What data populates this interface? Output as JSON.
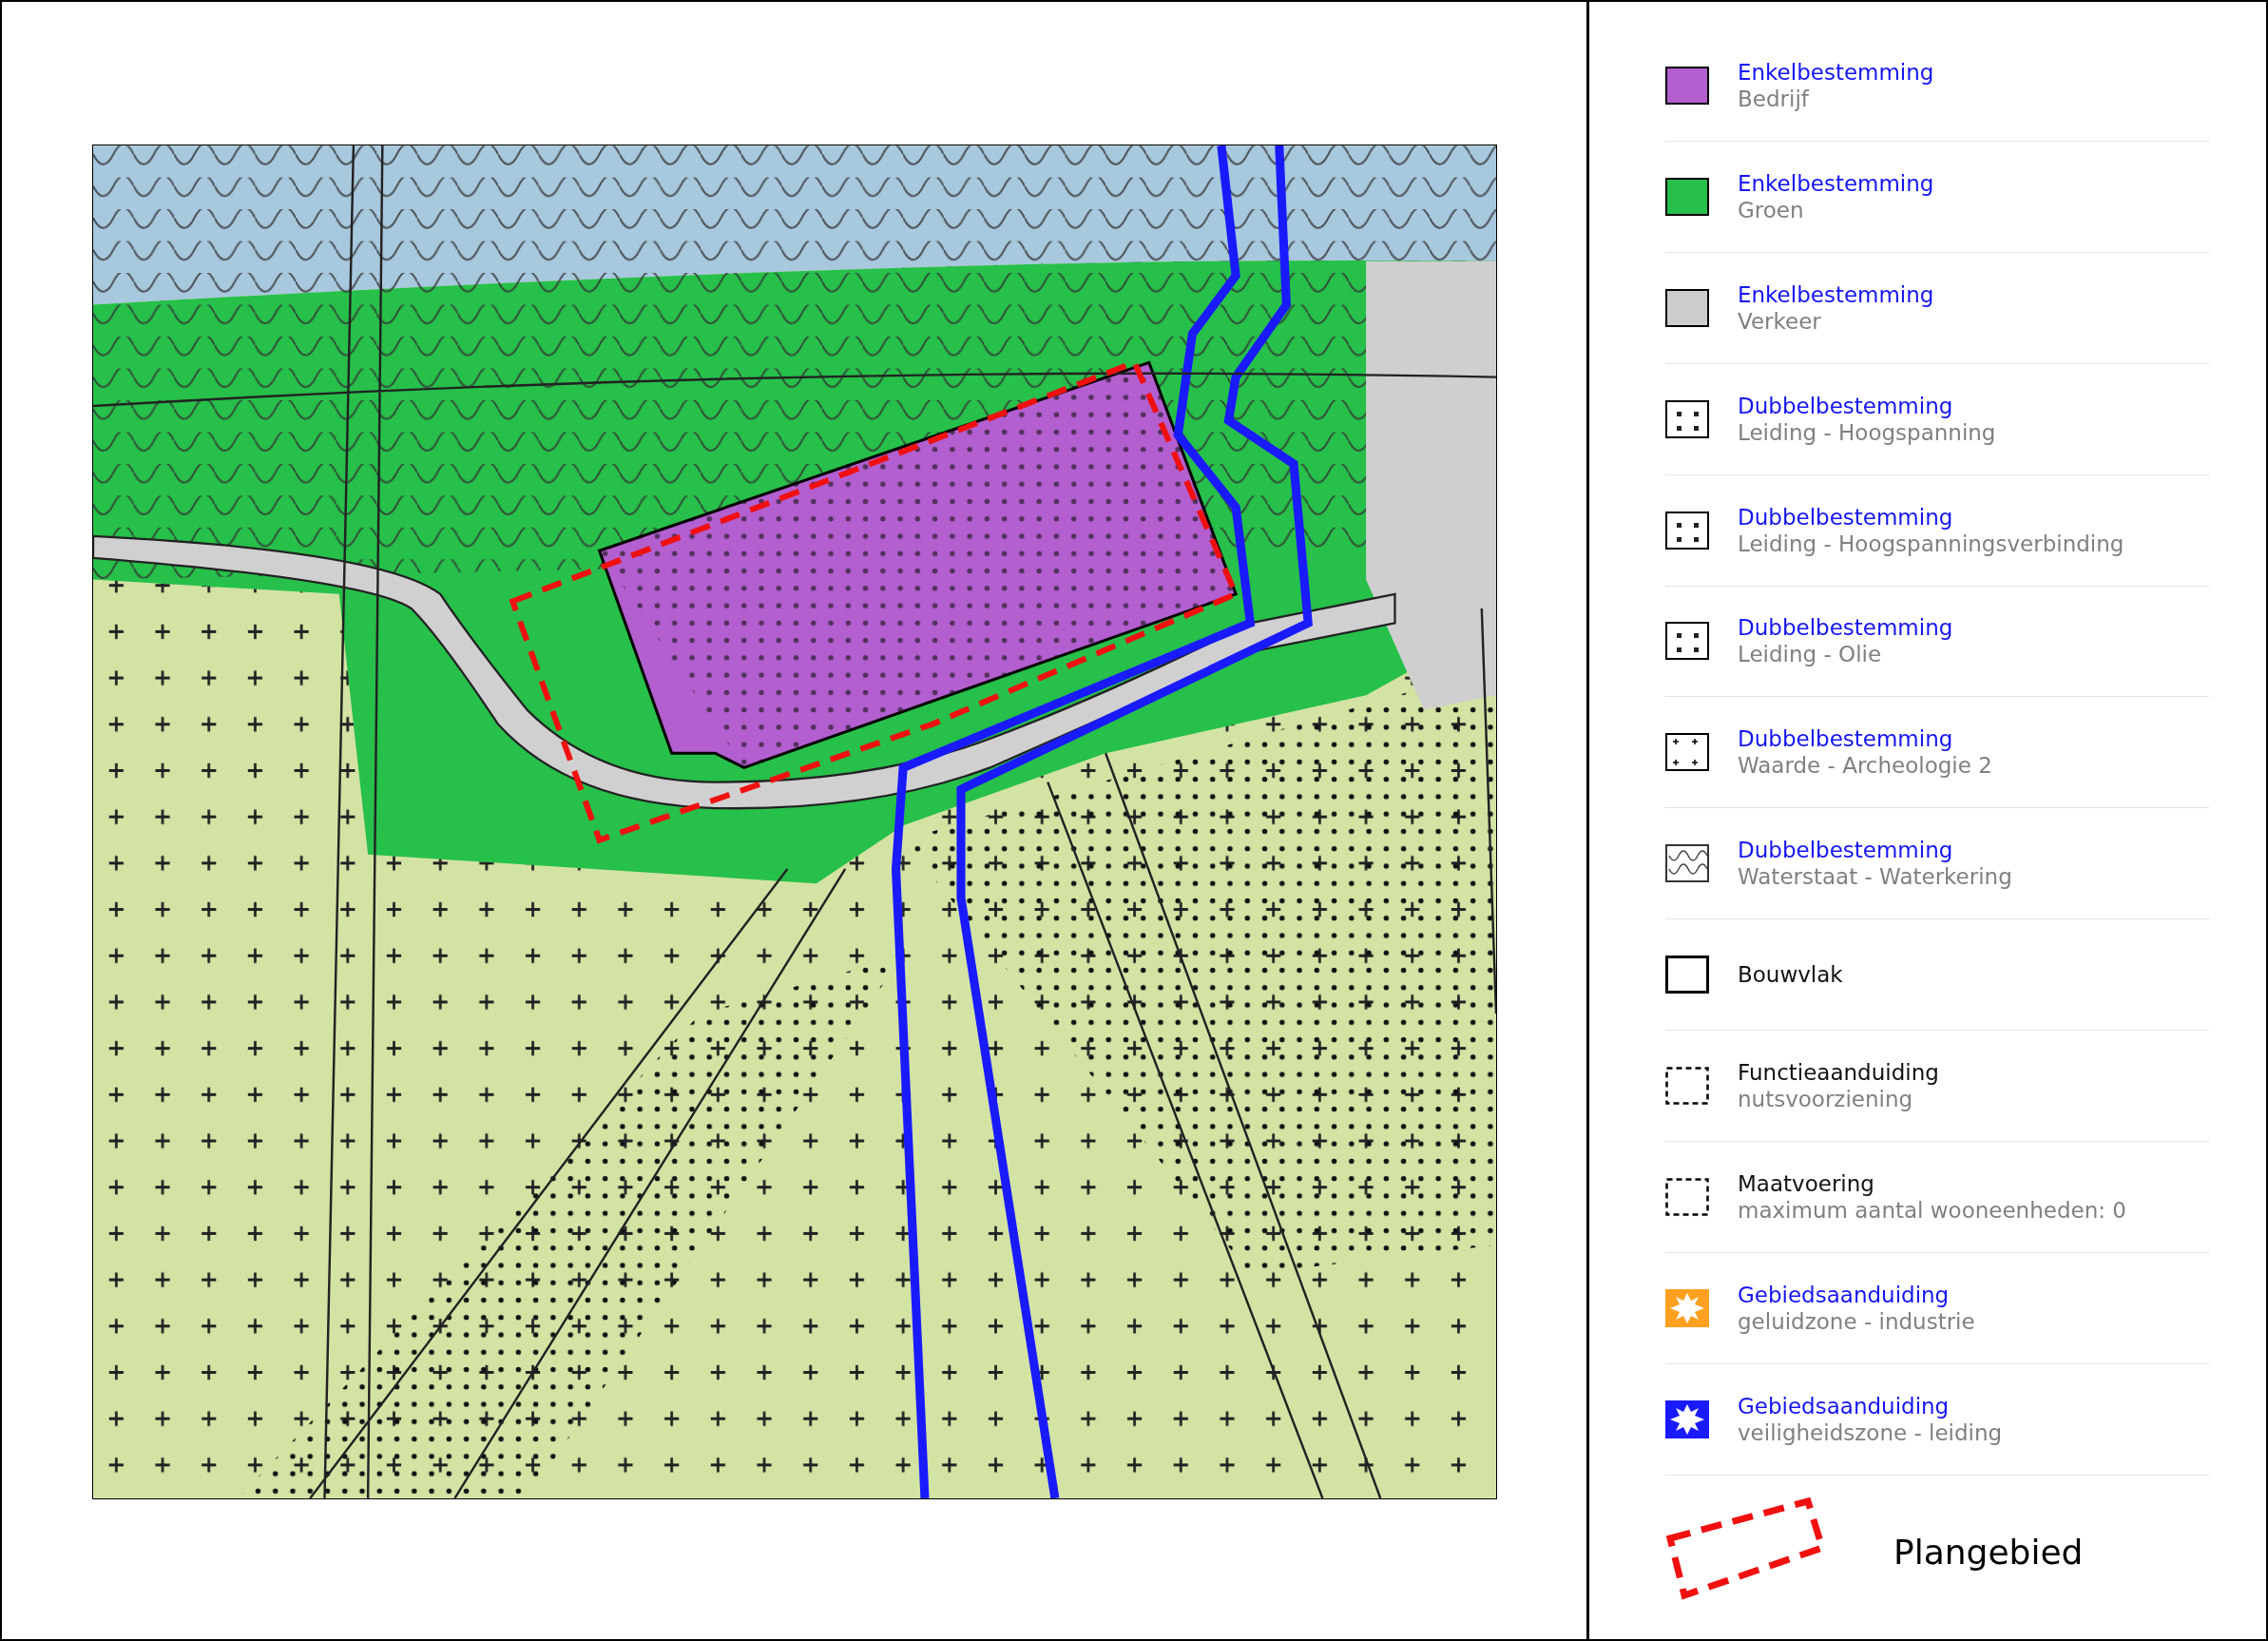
{
  "legend": {
    "items": [
      {
        "kind": "fill",
        "color": "#b35fd0",
        "link": true,
        "title": "Enkelbestemming",
        "subtitle": "Bedrijf"
      },
      {
        "kind": "fill",
        "color": "#26c04a",
        "link": true,
        "title": "Enkelbestemming",
        "subtitle": "Groen"
      },
      {
        "kind": "fill",
        "color": "#cccccc",
        "link": true,
        "title": "Enkelbestemming",
        "subtitle": "Verkeer"
      },
      {
        "kind": "dots",
        "link": true,
        "title": "Dubbelbestemming",
        "subtitle": "Leiding - Hoogspanning"
      },
      {
        "kind": "dots",
        "link": true,
        "title": "Dubbelbestemming",
        "subtitle": "Leiding - Hoogspanningsverbinding"
      },
      {
        "kind": "dots",
        "link": true,
        "title": "Dubbelbestemming",
        "subtitle": "Leiding - Olie"
      },
      {
        "kind": "crosses",
        "link": true,
        "title": "Dubbelbestemming",
        "subtitle": "Waarde - Archeologie 2"
      },
      {
        "kind": "waves",
        "link": true,
        "title": "Dubbelbestemming",
        "subtitle": "Waterstaat - Waterkering"
      },
      {
        "kind": "outline",
        "link": false,
        "title": "Bouwvlak"
      },
      {
        "kind": "dashed",
        "link": false,
        "title": "Functieaanduiding",
        "subtitle": "nutsvoorziening"
      },
      {
        "kind": "dashed",
        "link": false,
        "title": "Maatvoering",
        "subtitle": "maximum aantal wooneenheden: 0"
      },
      {
        "kind": "zone",
        "color": "#ffa020",
        "link": true,
        "title": "Gebiedsaanduiding",
        "subtitle": "geluidzone - industrie"
      },
      {
        "kind": "zone",
        "color": "#1a1aff",
        "link": true,
        "title": "Gebiedsaanduiding",
        "subtitle": "veiligheidszone - leiding"
      },
      {
        "kind": "plan",
        "link": false,
        "title": "Plangebied"
      }
    ]
  }
}
